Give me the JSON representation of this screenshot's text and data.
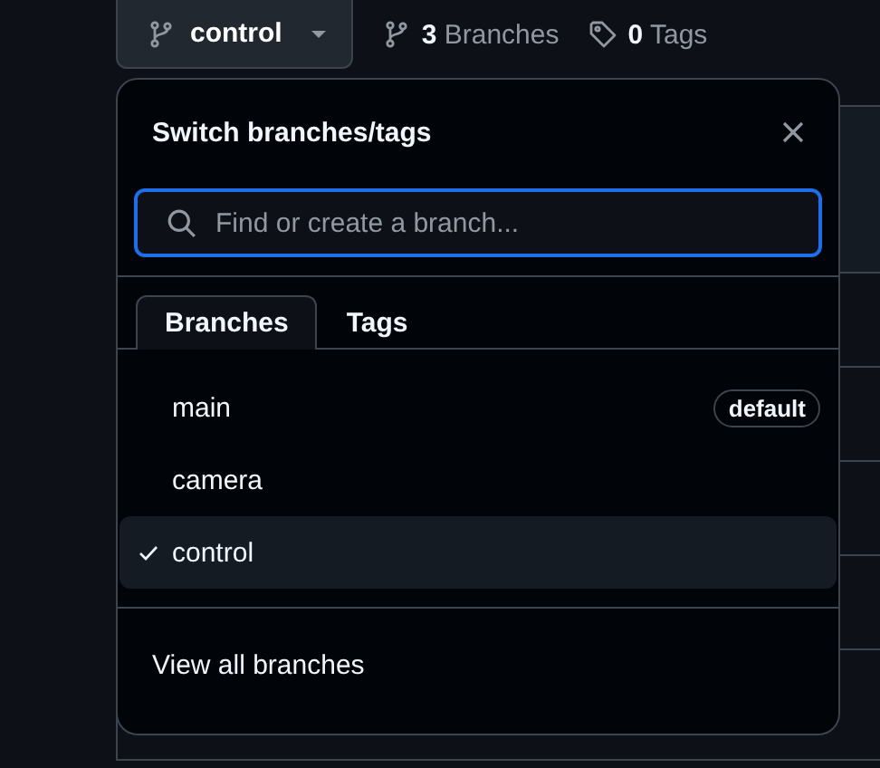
{
  "branch_button": {
    "label": "control"
  },
  "stats": [
    {
      "kind": "branch",
      "count": "3",
      "label": "Branches"
    },
    {
      "kind": "tag",
      "count": "0",
      "label": "Tags"
    }
  ],
  "popover": {
    "title": "Switch branches/tags",
    "search": {
      "placeholder": "Find or create a branch..."
    },
    "tabs": [
      {
        "label": "Branches",
        "selected": true
      },
      {
        "label": "Tags",
        "selected": false
      }
    ],
    "branches": [
      {
        "name": "main",
        "selected": false,
        "badge": "default"
      },
      {
        "name": "camera",
        "selected": false
      },
      {
        "name": "control",
        "selected": true
      }
    ],
    "footer_link": "View all branches"
  }
}
